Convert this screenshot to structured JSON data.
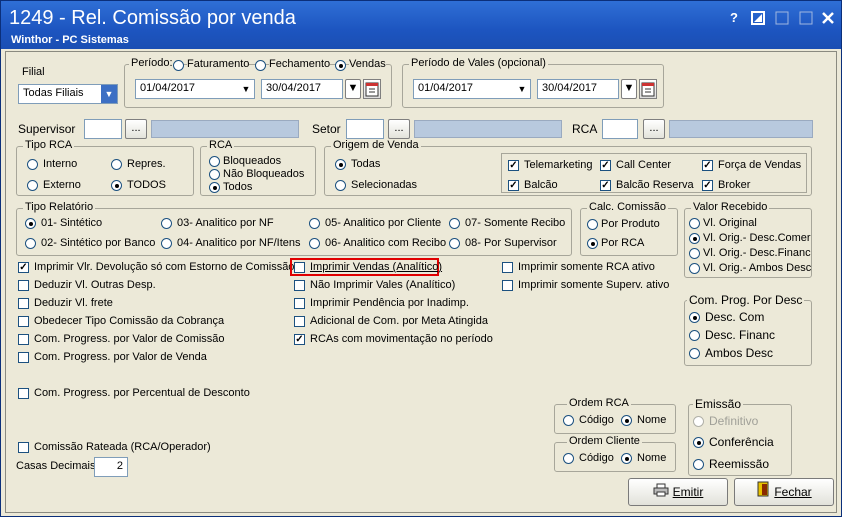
{
  "window": {
    "title": "1249 - Rel. Comissão por venda",
    "subtitle": "Winthor - PC Sistemas",
    "help_icon": "?",
    "controls": [
      "help-icon",
      "restore-icon",
      "minimize-icon",
      "close-icon"
    ]
  },
  "filial": {
    "label": "Filial",
    "value": "Todas Filiais"
  },
  "periodo": {
    "label": "Período:",
    "options": [
      "Faturamento",
      "Fechamento",
      "Vendas"
    ],
    "selected": "Vendas",
    "start": "01/04/2017",
    "end": "30/04/2017"
  },
  "periodo_vales": {
    "label": "Período de Vales (opcional)",
    "start": "01/04/2017",
    "end": "30/04/2017"
  },
  "lookups": {
    "supervisor": "Supervisor",
    "setor": "Setor",
    "rca": "RCA",
    "ellipsis": "..."
  },
  "tipo_rca": {
    "label": "Tipo RCA",
    "options": [
      "Interno",
      "Repres.",
      "Externo",
      "TODOS"
    ],
    "selected": "TODOS"
  },
  "rca_group": {
    "label": "RCA",
    "options": [
      "Bloqueados",
      "Não Bloqueados",
      "Todos"
    ],
    "selected": "Todos"
  },
  "origem_venda": {
    "label": "Origem de Venda",
    "options": [
      "Todas",
      "Selecionadas"
    ],
    "selected": "Todas",
    "checks": [
      {
        "label": "Telemarketing",
        "checked": true
      },
      {
        "label": "Call Center",
        "checked": true
      },
      {
        "label": "Força de Vendas",
        "checked": true
      },
      {
        "label": "Balcão",
        "checked": true
      },
      {
        "label": "Balcão Reserva",
        "checked": true
      },
      {
        "label": "Broker",
        "checked": true
      }
    ]
  },
  "tipo_relatorio": {
    "label": "Tipo Relatório",
    "options": [
      "01- Sintético",
      "03- Analitico por NF",
      "05- Analitico por Cliente",
      "07- Somente Recibo",
      "02- Sintético por Banco",
      "04- Analitico por NF/Itens",
      "06- Analitico com Recibo",
      "08- Por Supervisor"
    ],
    "selected": "01- Sintético"
  },
  "calc_comissao": {
    "label": "Calc. Comissão",
    "options": [
      "Por Produto",
      "Por RCA"
    ],
    "selected": "Por RCA"
  },
  "valor_recebido": {
    "label": "Valor Recebido",
    "options": [
      "Vl. Original",
      "Vl. Orig.- Desc.Comer",
      "Vl. Orig.- Desc.Financ",
      "Vl. Orig.- Ambos Desc"
    ],
    "selected": "Vl. Orig.- Desc.Comer"
  },
  "checks_col1": [
    {
      "label": "Imprimir Vlr. Devolução só com Estorno de Comissão",
      "checked": true
    },
    {
      "label": "Deduzir Vl. Outras Desp.",
      "checked": false
    },
    {
      "label": "Deduzir Vl. frete",
      "checked": false
    },
    {
      "label": "Obedecer Tipo Comissão da Cobrança",
      "checked": false
    },
    {
      "label": "Com. Progress. por Valor de Comissão",
      "checked": false
    },
    {
      "label": "Com. Progress. por Valor de Venda",
      "checked": false
    },
    {
      "label": "Com. Progress. por Percentual de Desconto",
      "checked": false
    },
    {
      "label": "Comissão Rateada (RCA/Operador)",
      "checked": false
    }
  ],
  "checks_col2": [
    {
      "label": "Imprimir Vendas (Analítico)",
      "checked": false
    },
    {
      "label": "Não Imprimir Vales (Analítico)",
      "checked": false
    },
    {
      "label": "Imprimir Pendência por Inadimp.",
      "checked": false
    },
    {
      "label": "Adicional de Com. por Meta Atingida",
      "checked": false
    },
    {
      "label": "RCAs com movimentação no período",
      "checked": true
    }
  ],
  "checks_col3": [
    {
      "label": "Imprimir somente RCA ativo",
      "checked": false
    },
    {
      "label": "Imprimir somente Superv. ativo",
      "checked": false
    }
  ],
  "com_prog_desc": {
    "label": "Com. Prog. Por Desc",
    "options": [
      "Desc. Com",
      "Desc. Financ",
      "Ambos Desc"
    ],
    "selected": "Desc. Com"
  },
  "ordem_rca": {
    "label": "Ordem RCA",
    "options": [
      "Código",
      "Nome"
    ],
    "selected": "Nome"
  },
  "ordem_cliente": {
    "label": "Ordem Cliente",
    "options": [
      "Código",
      "Nome"
    ],
    "selected": "Nome"
  },
  "emissao": {
    "label": "Emissão",
    "options": [
      "Definitivo",
      "Conferência",
      "Reemissão"
    ],
    "selected": "Conferência",
    "disabled": "Definitivo"
  },
  "casas_decimais": {
    "label": "Casas Decimais",
    "value": "2"
  },
  "buttons": {
    "emitir": "Emitir",
    "fechar": "Fechar"
  },
  "colors": {
    "title_bg": "#1d55c0",
    "highlight": "#e00000",
    "readonly": "#b8c9de"
  }
}
